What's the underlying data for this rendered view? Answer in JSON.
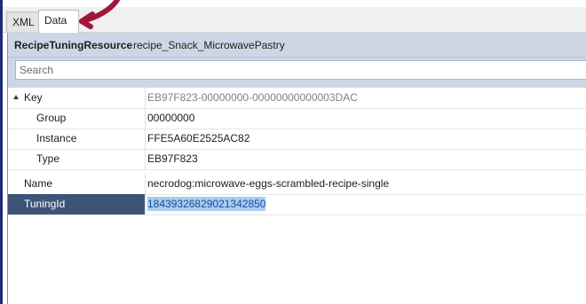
{
  "tabs": [
    {
      "label": "XML"
    },
    {
      "label": "Data"
    }
  ],
  "header": {
    "type": "RecipeTuningResource",
    "name": "recipe_Snack_MicrowavePastry"
  },
  "search": {
    "placeholder": "Search"
  },
  "properties": {
    "key": {
      "label": "Key",
      "value": "EB97F823-00000000-00000000000003DAC"
    },
    "group": {
      "label": "Group",
      "value": "00000000"
    },
    "instance": {
      "label": "Instance",
      "value": "FFE5A60E2525AC82"
    },
    "type": {
      "label": "Type",
      "value": "EB97F823"
    },
    "name": {
      "label": "Name",
      "value": "necrodog:microwave-eggs-scrambled-recipe-single"
    },
    "tuningid": {
      "label": "TuningId",
      "value": "18439326829021342850"
    }
  },
  "colors": {
    "header_bg": "#ccd7e6",
    "selected_row": "#3d5479",
    "highlight": "#a8cdf0",
    "annotation": "#a0173a"
  }
}
